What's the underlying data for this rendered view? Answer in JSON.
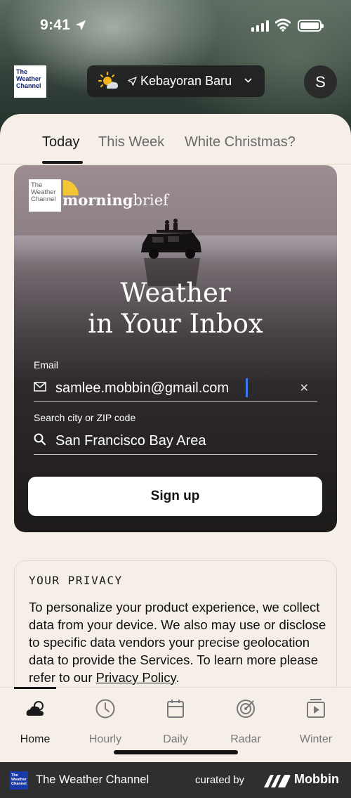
{
  "status_bar": {
    "time": "9:41"
  },
  "header": {
    "logo_lines": [
      "The",
      "Weather",
      "Channel"
    ],
    "location": "Kebayoran Baru",
    "avatar_initial": "S"
  },
  "tabs": [
    {
      "label": "Today",
      "active": true
    },
    {
      "label": "This Week",
      "active": false
    },
    {
      "label": "White Christmas?",
      "active": false
    }
  ],
  "card": {
    "brand_logo_lines": [
      "The",
      "Weather",
      "Channel"
    ],
    "brand_word_bold": "morning",
    "brand_word_light": "brief",
    "title_line1": "Weather",
    "title_line2": "in Your Inbox",
    "email_label": "Email",
    "email_value": "samlee.mobbin@gmail.com",
    "city_label": "Search city or ZIP code",
    "city_value": "San Francisco Bay Area",
    "signup_label": "Sign up"
  },
  "privacy": {
    "title": "YOUR PRIVACY",
    "text": "To personalize your product experience, we collect data from your device. We also may use or disclose to specific data vendors your precise geolocation data to provide the Services. To learn more please refer to our ",
    "link": "Privacy Policy",
    "text_end": "."
  },
  "bottom_nav": [
    {
      "label": "Home",
      "icon": "cloud-icon",
      "active": true
    },
    {
      "label": "Hourly",
      "icon": "clock-icon",
      "active": false
    },
    {
      "label": "Daily",
      "icon": "calendar-icon",
      "active": false
    },
    {
      "label": "Radar",
      "icon": "radar-icon",
      "active": false
    },
    {
      "label": "Winter",
      "icon": "video-icon",
      "active": false
    }
  ],
  "footer": {
    "logo_lines": [
      "The",
      "Weather",
      "Channel"
    ],
    "brand": "The Weather Channel",
    "curated_by": "curated by",
    "mobbin": "Mobbin"
  }
}
